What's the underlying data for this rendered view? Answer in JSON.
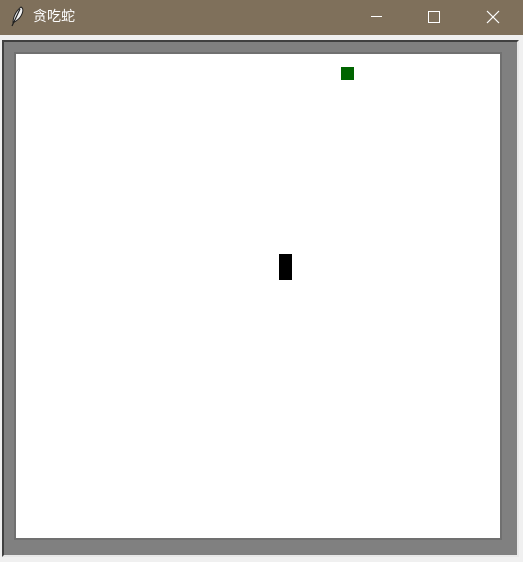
{
  "window": {
    "title": "贪吃蛇",
    "controls": {
      "minimize_icon": "minimize-icon",
      "maximize_icon": "maximize-icon",
      "close_icon": "close-icon"
    }
  },
  "colors": {
    "titlebar_bg": "#7f705b",
    "frame": "#808080",
    "board": "#ffffff",
    "food": "#006400",
    "snake": "#000000"
  },
  "game": {
    "food_icon": "food-square",
    "snake_icon": "snake-segment"
  }
}
